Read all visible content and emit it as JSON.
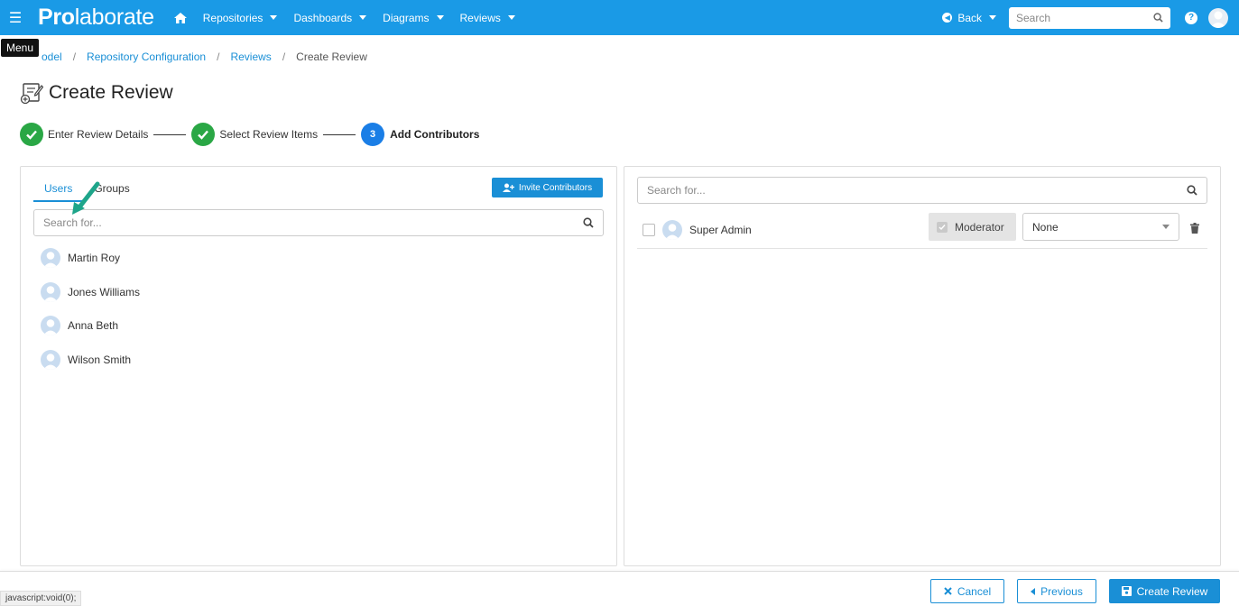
{
  "topnav": {
    "menu_icon": "hamburger-icon",
    "logo_bold": "Pro",
    "logo_rest": "laborate",
    "items": [
      {
        "label": "Repositories"
      },
      {
        "label": "Dashboards"
      },
      {
        "label": "Diagrams"
      },
      {
        "label": "Reviews"
      }
    ],
    "back_label": "Back",
    "search_placeholder": "Search",
    "accent": "#1a9ae6"
  },
  "tooltip": "Menu",
  "breadcrumb": {
    "items": [
      "odel",
      "Repository Configuration",
      "Reviews"
    ],
    "current": "Create Review"
  },
  "page": {
    "title": "Create Review"
  },
  "stepper": {
    "steps": [
      {
        "label": "Enter Review Details",
        "status": "done"
      },
      {
        "label": "Select Review Items",
        "status": "done"
      },
      {
        "label": "Add Contributors",
        "number": "3",
        "status": "active"
      }
    ],
    "done_color": "#2aa745",
    "active_color": "#1a7ee6"
  },
  "left_panel": {
    "tabs": [
      "Users",
      "Groups"
    ],
    "active_tab": "Users",
    "invite_label": "Invite Contributors",
    "search_placeholder": "Search for...",
    "users": [
      {
        "name": "Martin Roy"
      },
      {
        "name": "Jones Williams"
      },
      {
        "name": "Anna Beth"
      },
      {
        "name": "Wilson Smith"
      }
    ]
  },
  "right_panel": {
    "search_placeholder": "Search for...",
    "contributors": [
      {
        "name": "Super Admin",
        "role_label": "Moderator",
        "permission": "None"
      }
    ]
  },
  "footer": {
    "status_url": "javascript:void(0);",
    "cancel_label": "Cancel",
    "previous_label": "Previous",
    "create_label": "Create Review"
  }
}
